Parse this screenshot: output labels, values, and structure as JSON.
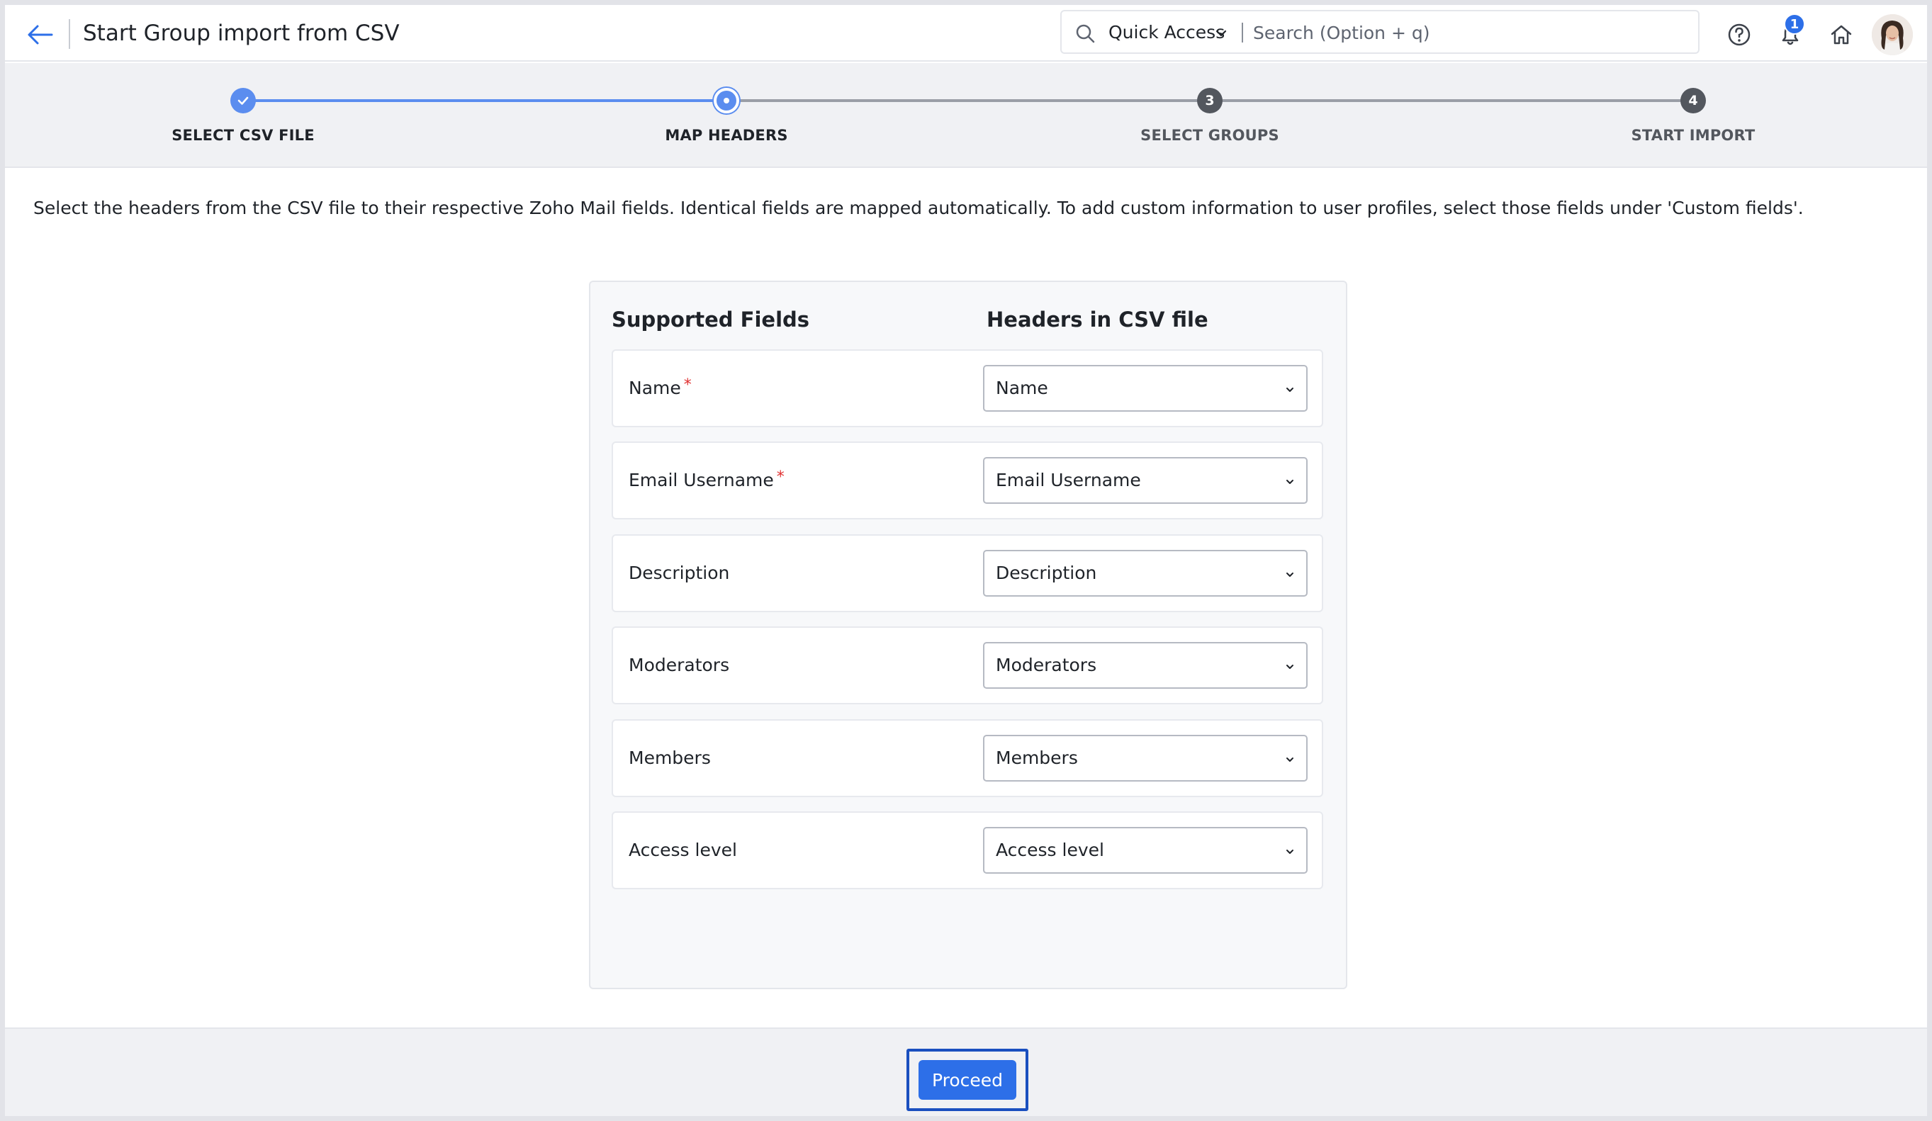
{
  "header": {
    "title": "Start Group import from CSV",
    "quick_access_label": "Quick Access",
    "search_placeholder": "Search (Option + q)",
    "notification_count": "1",
    "accent_color": "#2d6fe8"
  },
  "stepper": {
    "steps": [
      {
        "label": "SELECT CSV FILE",
        "number": "",
        "state": "completed"
      },
      {
        "label": "MAP HEADERS",
        "number": "",
        "state": "current"
      },
      {
        "label": "SELECT GROUPS",
        "number": "3",
        "state": "pending"
      },
      {
        "label": "START IMPORT",
        "number": "4",
        "state": "pending"
      }
    ],
    "completed_color": "#5b8def",
    "pending_color": "#53575e"
  },
  "main": {
    "intro": "Select the headers from the CSV file to their respective Zoho Mail fields. Identical fields are mapped automatically. To add custom information to user profiles, select those fields under 'Custom fields'.",
    "col_supported": "Supported Fields",
    "col_headers": "Headers in CSV file",
    "fields": [
      {
        "label": "Name",
        "required": "*",
        "value": "Name"
      },
      {
        "label": "Email Username",
        "required": "*",
        "value": "Email Username"
      },
      {
        "label": "Description",
        "required": "",
        "value": "Description"
      },
      {
        "label": "Moderators",
        "required": "",
        "value": "Moderators"
      },
      {
        "label": "Members",
        "required": "",
        "value": "Members"
      },
      {
        "label": "Access level",
        "required": "",
        "value": "Access level"
      }
    ]
  },
  "footer": {
    "proceed_label": "Proceed"
  }
}
